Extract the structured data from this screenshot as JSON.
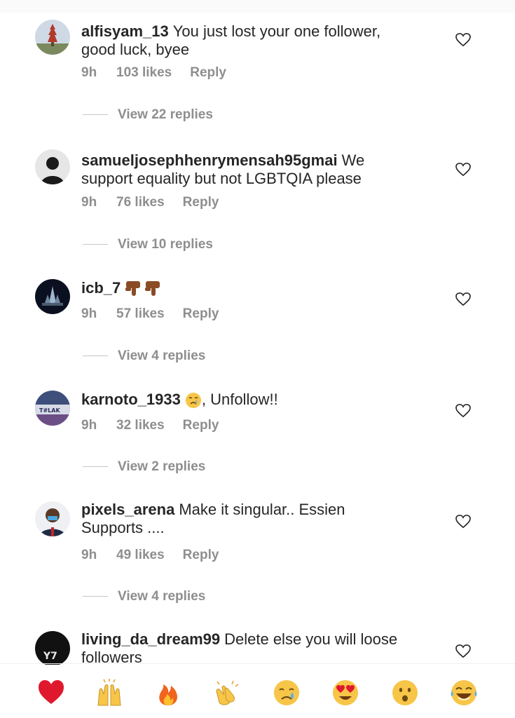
{
  "comments": [
    {
      "username": "alfisyam_13",
      "text": "You just lost your one follower,",
      "text2": "good luck, byee",
      "time": "9h",
      "likes": "103 likes",
      "reply": "Reply",
      "view_replies": "View 22 replies"
    },
    {
      "username": "samueljosephhenrymensah95gmai",
      "text": "We",
      "text2": "support equality but not LGBTQIA please",
      "time": "9h",
      "likes": "76 likes",
      "reply": "Reply",
      "view_replies": "View 10 replies"
    },
    {
      "username": "icb_7",
      "emoji": "thumbs-down-icon x2",
      "time": "9h",
      "likes": "57 likes",
      "reply": "Reply",
      "view_replies": "View 4 replies"
    },
    {
      "username": "karnoto_1933",
      "text": ", Unfollow!!",
      "emoji": "crying-face-icon",
      "time": "9h",
      "likes": "32 likes",
      "reply": "Reply",
      "view_replies": "View 2 replies"
    },
    {
      "username": "pixels_arena",
      "text": "Make it singular.. Essien",
      "text2": "Supports ....",
      "time": "9h",
      "likes": "49 likes",
      "reply": "Reply",
      "view_replies": "View 4 replies"
    },
    {
      "username": "living_da_dream99",
      "text": "Delete else you will loose",
      "text2": "followers"
    }
  ],
  "emoji_bar": [
    "red-heart-icon",
    "raising-hands-icon",
    "fire-icon",
    "clapping-hands-icon",
    "crying-face-icon",
    "heart-eyes-icon",
    "surprised-face-icon",
    "tears-of-joy-icon"
  ],
  "colors": {
    "text": "#262626",
    "meta": "#8e8e8e",
    "background": "#ffffff"
  }
}
